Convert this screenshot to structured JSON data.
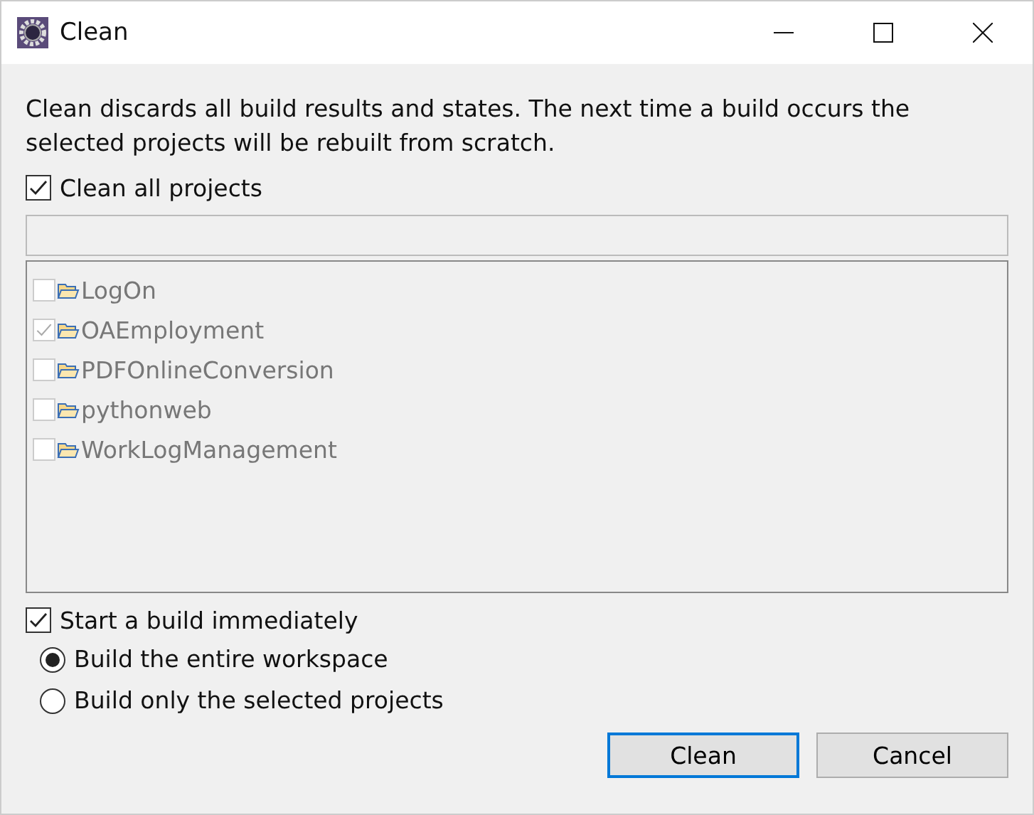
{
  "window": {
    "title": "Clean"
  },
  "description": "Clean discards all build results and states.  The next time a build occurs the selected projects will be rebuilt from scratch.",
  "clean_all": {
    "label": "Clean all projects",
    "checked": true
  },
  "filter": {
    "disabled": true
  },
  "projects": {
    "disabled": true,
    "items": [
      {
        "label": "LogOn",
        "checked": false
      },
      {
        "label": "OAEmployment",
        "checked": true
      },
      {
        "label": "PDFOnlineConversion",
        "checked": false
      },
      {
        "label": "pythonweb",
        "checked": false
      },
      {
        "label": "WorkLogManagement",
        "checked": false
      }
    ]
  },
  "start_build": {
    "label": "Start a build immediately",
    "checked": true
  },
  "build_options": [
    {
      "label": "Build the entire workspace",
      "selected": true
    },
    {
      "label": "Build only the selected projects",
      "selected": false
    }
  ],
  "buttons": [
    {
      "label": "Clean",
      "default": true
    },
    {
      "label": "Cancel",
      "default": false
    }
  ]
}
